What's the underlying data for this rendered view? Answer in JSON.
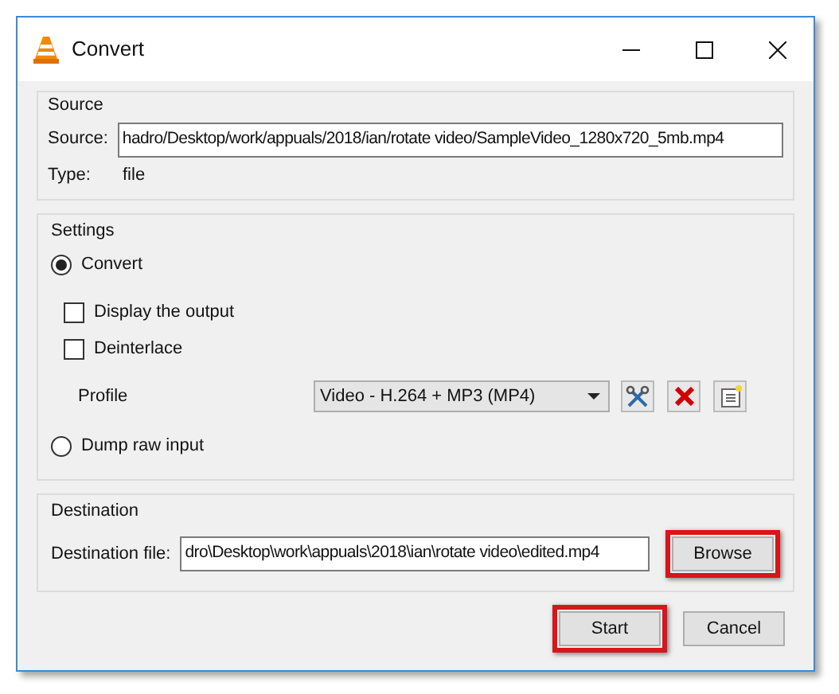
{
  "window": {
    "title": "Convert"
  },
  "source": {
    "title": "Source",
    "label": "Source:",
    "value": "hadro/Desktop/work/appuals/2018/ian/rotate video/SampleVideo_1280x720_5mb.mp4",
    "type_label": "Type:",
    "type_value": "file"
  },
  "settings": {
    "title": "Settings",
    "options": [
      {
        "kind": "radio",
        "label": "Convert",
        "selected": true
      },
      {
        "kind": "checkbox",
        "label": "Display the output",
        "checked": false
      },
      {
        "kind": "checkbox",
        "label": "Deinterlace",
        "checked": false
      },
      {
        "kind": "profile",
        "label": "Profile",
        "value": "Video - H.264 + MP3 (MP4)"
      },
      {
        "kind": "radio",
        "label": "Dump raw input",
        "selected": false
      }
    ]
  },
  "destination": {
    "title": "Destination",
    "label": "Destination file:",
    "value": "dro\\Desktop\\work\\appuals\\2018\\ian\\rotate video\\edited.mp4",
    "browse": {
      "label": "Browse",
      "highlighted": true
    }
  },
  "buttons": [
    {
      "label": "Start",
      "highlighted": true
    },
    {
      "label": "Cancel",
      "highlighted": false
    }
  ]
}
